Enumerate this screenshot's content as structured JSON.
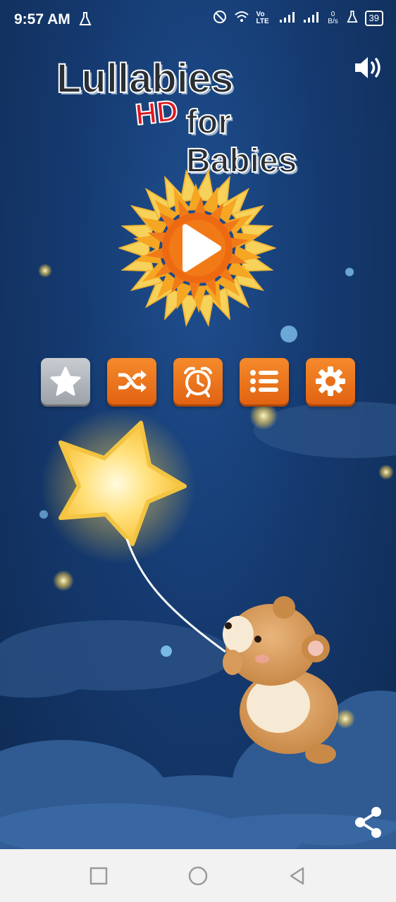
{
  "status_bar": {
    "time": "9:57 AM",
    "lab_icon": "flask-icon",
    "network_label": "Vo LTE",
    "data_rate": "0 B/s",
    "battery": "39"
  },
  "logo": {
    "line1": "Lullabies",
    "hd": "HD",
    "line2": "for Babies"
  },
  "icons": {
    "sound": "speaker-icon",
    "play": "play-icon",
    "favorites": "star-icon",
    "shuffle": "shuffle-icon",
    "timer": "alarm-clock-icon",
    "playlist": "list-icon",
    "settings": "gear-icon",
    "share": "share-icon"
  },
  "colors": {
    "accent": "#f07a20",
    "background": "#153a70",
    "logo_red": "#e0171f"
  }
}
